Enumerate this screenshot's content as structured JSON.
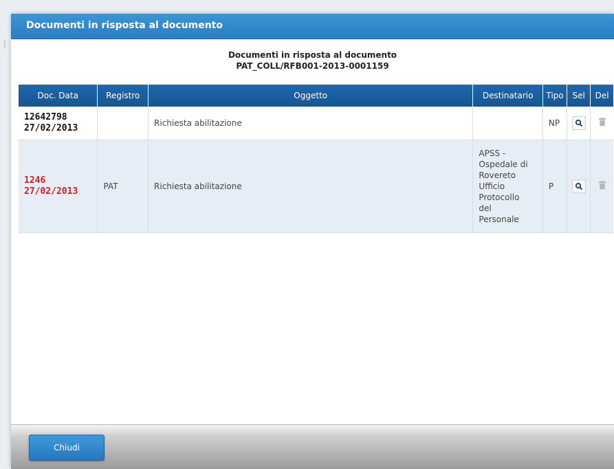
{
  "dialog": {
    "title": "Documenti in risposta al documento",
    "heading_line1": "Documenti in risposta al documento",
    "heading_line2": "PAT_COLL/RFB001-2013-0001159"
  },
  "table": {
    "columns": [
      "Doc. Data",
      "Registro",
      "Oggetto",
      "Destinatario",
      "Tipo",
      "Sel",
      "Del"
    ],
    "rows": [
      {
        "doc_number": "12642798",
        "doc_date": "27/02/2013",
        "registro": "",
        "oggetto": "Richiesta abilitazione",
        "destinatario": "",
        "tipo": "NP",
        "number_color": "#111111"
      },
      {
        "doc_number": "1246",
        "doc_date": "27/02/2013",
        "registro": "PAT",
        "oggetto": "Richiesta abilitazione",
        "destinatario_lines": [
          "APSS -",
          "Ospedale di",
          "Rovereto",
          "Ufficio",
          "Protocollo",
          "del",
          "Personale"
        ],
        "tipo": "P",
        "number_color": "#d21e1e"
      }
    ]
  },
  "footer": {
    "close_label": "Chiudi"
  },
  "icons": {
    "select": "magnifier-icon",
    "delete": "trash-icon"
  },
  "colors": {
    "titlebar": "#2a7ec4",
    "header": "#175592",
    "alt_row": "#e6edf5",
    "highlight_text": "#d21e1e"
  }
}
